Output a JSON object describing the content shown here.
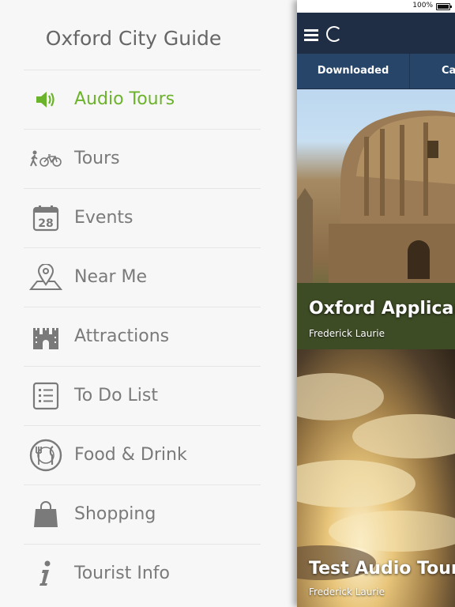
{
  "menu": {
    "title": "Oxford City Guide",
    "items": [
      {
        "label": "Audio Tours",
        "icon": "speaker-icon",
        "active": true
      },
      {
        "label": "Tours",
        "icon": "walk-bike-icon",
        "active": false
      },
      {
        "label": "Events",
        "icon": "calendar-icon",
        "active": false
      },
      {
        "label": "Near Me",
        "icon": "map-pin-icon",
        "active": false
      },
      {
        "label": "Attractions",
        "icon": "castle-icon",
        "active": false
      },
      {
        "label": "To Do List",
        "icon": "checklist-icon",
        "active": false
      },
      {
        "label": "Food & Drink",
        "icon": "plate-cutlery-icon",
        "active": false
      },
      {
        "label": "Shopping",
        "icon": "shopping-bag-icon",
        "active": false
      },
      {
        "label": "Tourist Info",
        "icon": "info-icon",
        "active": false
      }
    ],
    "calendar_day": "28"
  },
  "status": {
    "battery": "100%"
  },
  "tabs": [
    "Downloaded",
    "Cat"
  ],
  "cards": [
    {
      "title": "Oxford Applicant",
      "author": "Frederick Laurie"
    },
    {
      "title": "Test Audio Tour",
      "author": "Frederick Laurie"
    }
  ],
  "colors": {
    "accent": "#6cb32c",
    "navbar": "#1f2e45",
    "tabbar": "#264569",
    "menu_text": "#7a7a7a"
  }
}
